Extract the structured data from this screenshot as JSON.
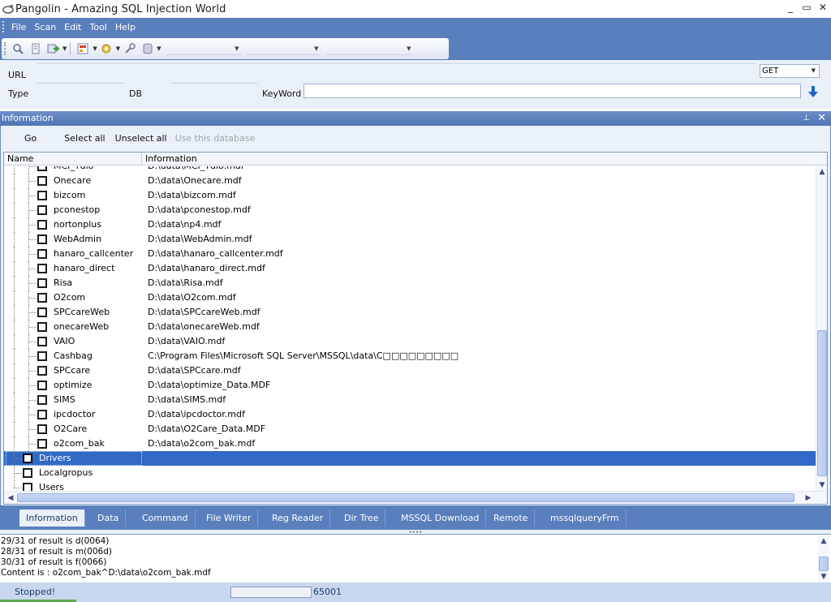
{
  "window": {
    "title": "Pangolin - Amazing SQL Injection World",
    "controls": [
      "_",
      "▭",
      "✕"
    ]
  },
  "menu": {
    "items": [
      "File",
      "Scan",
      "Edit",
      "Tool",
      "Help"
    ]
  },
  "inputs": {
    "url_label": "URL",
    "type_label": "Type",
    "db_label": "DB",
    "keyword_label": "KeyWord",
    "method_value": "GET",
    "keyword_value": ""
  },
  "panel": {
    "title": "Information",
    "pin_glyph": "📌",
    "close_glyph": "✕",
    "actions": {
      "go": "Go",
      "select_all": "Select all",
      "unselect_all": "Unselect all",
      "use_db": "Use this database"
    },
    "columns": {
      "name": "Name",
      "information": "Information"
    }
  },
  "tree": {
    "partial_row": {
      "name": "MCI_Tdlo",
      "info": "D:\\data\\MCI_Tdlo.mdf"
    },
    "databases": [
      {
        "name": "Onecare",
        "info": "D:\\data\\Onecare.mdf"
      },
      {
        "name": "bizcom",
        "info": "D:\\data\\bizcom.mdf"
      },
      {
        "name": "pconestop",
        "info": "D:\\data\\pconestop.mdf"
      },
      {
        "name": "nortonplus",
        "info": "D:\\data\\np4.mdf"
      },
      {
        "name": "WebAdmin",
        "info": "D:\\data\\WebAdmin.mdf"
      },
      {
        "name": "hanaro_callcenter",
        "info": "D:\\data\\hanaro_callcenter.mdf"
      },
      {
        "name": "hanaro_direct",
        "info": "D:\\data\\hanaro_direct.mdf"
      },
      {
        "name": "Risa",
        "info": "D:\\data\\Risa.mdf"
      },
      {
        "name": "O2com",
        "info": "D:\\data\\O2com.mdf"
      },
      {
        "name": "SPCcareWeb",
        "info": "D:\\data\\SPCcareWeb.mdf"
      },
      {
        "name": "onecareWeb",
        "info": "D:\\data\\onecareWeb.mdf"
      },
      {
        "name": "VAIO",
        "info": "D:\\data\\VAIO.mdf"
      },
      {
        "name": "Cashbag",
        "info": "C:\\Program Files\\Microsoft SQL Server\\MSSQL\\data\\C□□□□□□□□□"
      },
      {
        "name": "SPCcare",
        "info": "D:\\data\\SPCcare.mdf"
      },
      {
        "name": "optimize",
        "info": "D:\\data\\optimize_Data.MDF"
      },
      {
        "name": "SIMS",
        "info": "D:\\data\\SIMS.mdf"
      },
      {
        "name": "ipcdoctor",
        "info": "D:\\data\\ipcdoctor.mdf"
      },
      {
        "name": "O2Care",
        "info": "D:\\data\\O2Care_Data.MDF"
      },
      {
        "name": "o2com_bak",
        "info": "D:\\data\\o2com_bak.mdf"
      }
    ],
    "top_nodes": [
      {
        "name": "Drivers",
        "selected": true
      },
      {
        "name": "Localgropus",
        "selected": false
      },
      {
        "name": "Users",
        "selected": false
      }
    ]
  },
  "tabs": [
    {
      "label": "Information",
      "active": true
    },
    {
      "label": "Data",
      "active": false
    },
    {
      "label": "Command",
      "active": false
    },
    {
      "label": "File Writer",
      "active": false
    },
    {
      "label": "Reg Reader",
      "active": false
    },
    {
      "label": "Dir Tree",
      "active": false
    },
    {
      "label": "MSSQL Download",
      "active": false
    },
    {
      "label": "Remote",
      "active": false
    },
    {
      "label": "mssqlqueryFrm",
      "active": false
    }
  ],
  "log": {
    "lines": [
      "29/31 of result is d(0064)",
      "28/31 of result is m(006d)",
      "30/31 of result is f(0066)",
      "Content is : o2com_bak^D:\\data\\o2com_bak.mdf"
    ]
  },
  "status": {
    "text": "Stopped!",
    "count": "65001"
  },
  "colors": {
    "menubar": "#5a7fbd",
    "selection": "#3169c6",
    "panel_bg": "#eaf0f8"
  },
  "icons": [
    "search-icon",
    "document-icon",
    "export-icon",
    "report-icon",
    "settings-icon",
    "wrench-icon",
    "database-icon"
  ]
}
